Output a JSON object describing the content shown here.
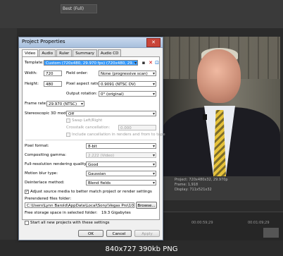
{
  "host": {
    "zoom_combo": "Best (Full)",
    "preview_info": [
      "Project: 720x480x32, 29.970p",
      "Frame: 1,918",
      "Display: 711x521x32"
    ],
    "timeline_marks": [
      "00:00:59;29",
      "00:01:09;29"
    ]
  },
  "dialog": {
    "title": "Project Properties",
    "close_label": "✕",
    "tabs": [
      "Video",
      "Audio",
      "Ruler",
      "Summary",
      "Audio CD"
    ],
    "template_label": "Template:",
    "template_value": "Custom (720x480, 29.970 fps) (720x480, 29...",
    "width_label": "Width:",
    "width_value": "720",
    "height_label": "Height:",
    "height_value": "480",
    "field_order_label": "Field order:",
    "field_order_value": "None (progressive scan)",
    "pixel_aspect_label": "Pixel aspect ratio:",
    "pixel_aspect_value": "0.9091 (NTSC DV)",
    "output_rotation_label": "Output rotation:",
    "output_rotation_value": "0° (original)",
    "frame_rate_label": "Frame rate:",
    "frame_rate_value": "29.970 (NTSC)",
    "stereo_label": "Stereoscopic 3D mode:",
    "stereo_value": "Off",
    "swap_label": "Swap Left/Right",
    "crosstalk_label": "Crosstalk cancellation:",
    "crosstalk_value": "0.000",
    "include_cancel_label": "Include cancellation in renders and from to tape",
    "pixel_format_label": "Pixel format:",
    "pixel_format_value": "8-bit",
    "compositing_label": "Compositing gamma:",
    "compositing_value": "2.222 (Video)",
    "render_quality_label": "Full-resolution rendering quality:",
    "render_quality_value": "Good",
    "motion_blur_label": "Motion blur type:",
    "motion_blur_value": "Gaussian",
    "deinterlace_label": "Deinterlace method:",
    "deinterlace_value": "Blend fields",
    "adjust_label": "Adjust source media to better match project or render settings",
    "prerendered_label": "Prerendered files folder:",
    "prerendered_value": "C:\\Users\\Lynn Barold\\AppData\\Local\\Sony\\Vegas Pro\\10.0\\",
    "browse_label": "Browse...",
    "free_storage_label": "Free storage space in selected folder:",
    "free_storage_value": "19.3 Gigabytes",
    "start_all_label": "Start all new projects with these settings",
    "ok_label": "OK",
    "cancel_label": "Cancel",
    "apply_label": "Apply"
  },
  "footer": {
    "caption": "840x727  390kb  PNG"
  }
}
